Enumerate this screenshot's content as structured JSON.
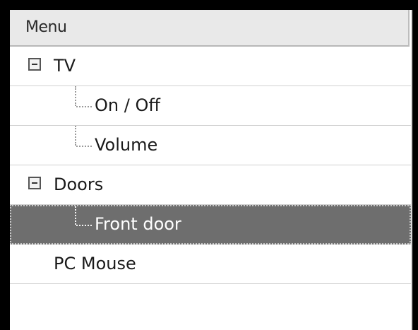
{
  "menu": {
    "header": "Menu",
    "items": [
      {
        "label": "TV",
        "level": 0,
        "expanded": true
      },
      {
        "label": "On / Off",
        "level": 1
      },
      {
        "label": "Volume",
        "level": 1
      },
      {
        "label": "Doors",
        "level": 0,
        "expanded": true
      },
      {
        "label": "Front door",
        "level": 1,
        "selected": true
      },
      {
        "label": "PC Mouse",
        "level": 0
      }
    ]
  },
  "colors": {
    "selection": "#6e6e6e",
    "header_bg": "#e9e9e9"
  },
  "icons": {
    "expander": "minus-box-icon"
  }
}
